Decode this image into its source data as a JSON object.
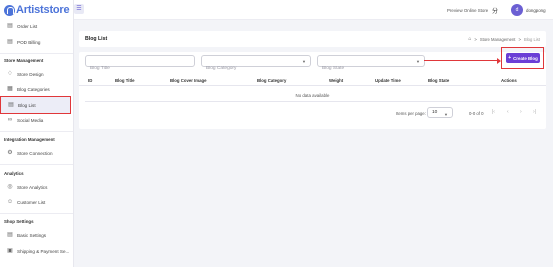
{
  "brand": {
    "logo_text": "Artiststore"
  },
  "sidebar": {
    "top_items": [
      {
        "label": "Order List",
        "icon": "receipt-icon"
      },
      {
        "label": "POD Billing",
        "icon": "document-icon"
      }
    ],
    "sections": [
      {
        "title": "Store Management",
        "items": [
          {
            "label": "Store Design",
            "icon": "palette-icon"
          },
          {
            "label": "Blog Categories",
            "icon": "grid-icon"
          },
          {
            "label": "Blog List",
            "icon": "list-icon",
            "active": true
          },
          {
            "label": "Social Media",
            "icon": "link-icon"
          }
        ]
      },
      {
        "title": "Integration Management",
        "items": [
          {
            "label": "Store Connection",
            "icon": "gear-icon"
          }
        ]
      },
      {
        "title": "Analytics",
        "items": [
          {
            "label": "Store Analytics",
            "icon": "chart-icon"
          },
          {
            "label": "Customer List",
            "icon": "users-icon"
          }
        ]
      },
      {
        "title": "Shop Settings",
        "items": [
          {
            "label": "Basic Settings",
            "icon": "document-icon"
          },
          {
            "label": "Shipping & Payment Se...",
            "icon": "truck-icon"
          }
        ]
      }
    ]
  },
  "topbar": {
    "preview_label": "Preview Online Store",
    "user_initial": "d",
    "username": "dongpong"
  },
  "page": {
    "title": "Blog List",
    "breadcrumb": [
      "Store Management",
      "Blog List"
    ]
  },
  "filters": {
    "title_placeholder": "Blog Title",
    "category_placeholder": "Blog Category",
    "state_placeholder": "Blog State"
  },
  "create_button": {
    "label": "Create Blog"
  },
  "table": {
    "columns": [
      "ID",
      "Blog Title",
      "Blog Cover Image",
      "Blog Category",
      "Weight",
      "Update Time",
      "Blog State",
      "Actions"
    ],
    "empty_text": "No data available"
  },
  "pagination": {
    "items_per_page_label": "Items per page:",
    "items_per_page_value": "10",
    "range_text": "0-0 of 0"
  },
  "colors": {
    "accent": "#6b3fd6",
    "highlight": "#e0373a",
    "brand": "#4d74d9"
  }
}
